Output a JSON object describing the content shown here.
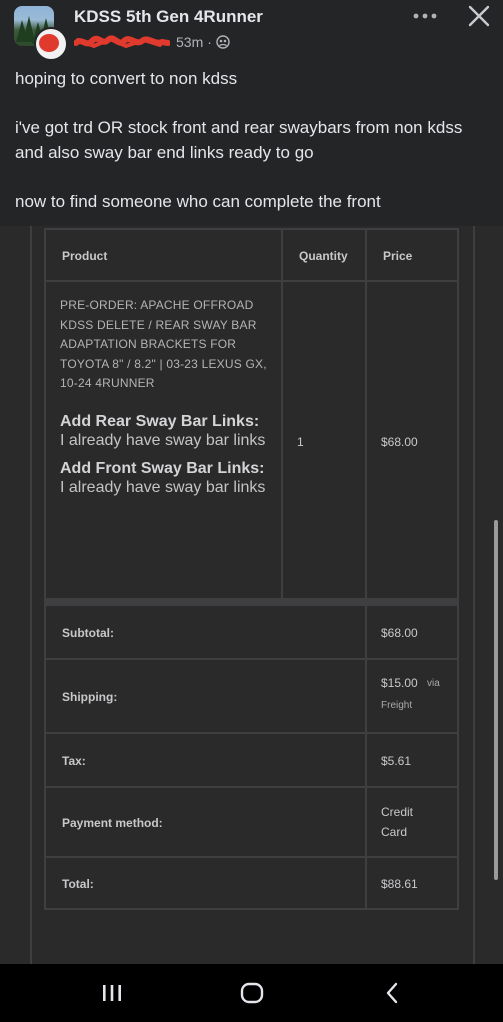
{
  "header": {
    "group_name": "KDSS 5th Gen 4Runner",
    "time": "53m",
    "separator": "·"
  },
  "post": {
    "paragraphs": [
      "hoping to convert to non kdss",
      "i've got trd OR stock front and rear swaybars from non kdss and also sway bar end links ready to go",
      "now to find someone who can complete the front"
    ]
  },
  "order": {
    "headers": {
      "product": "Product",
      "quantity": "Quantity",
      "price": "Price"
    },
    "item": {
      "name": "PRE-ORDER: APACHE OFFROAD KDSS DELETE / REAR SWAY BAR ADAPTATION BRACKETS FOR TOYOTA 8\" / 8.2\" | 03-23 LEXUS GX, 10-24 4RUNNER",
      "addon_1_title": "Add Rear Sway Bar Links:",
      "addon_1_value": "I already have sway bar links",
      "addon_2_title": "Add Front Sway Bar Links:",
      "addon_2_value": "I already have sway bar links",
      "quantity": "1",
      "price": "$68.00"
    },
    "totals": {
      "subtotal_label": "Subtotal:",
      "subtotal_value": "$68.00",
      "shipping_label": "Shipping:",
      "shipping_value": "$15.00",
      "shipping_via": "via",
      "shipping_method": "Freight",
      "tax_label": "Tax:",
      "tax_value": "$5.61",
      "payment_label": "Payment method:",
      "payment_value_1": "Credit",
      "payment_value_2": "Card",
      "total_label": "Total:",
      "total_value": "$88.61"
    }
  },
  "icons": {
    "more": "more-horizontal-icon",
    "close": "close-icon",
    "audience": "group-audience-icon",
    "nav_recents": "recents-icon",
    "nav_home": "home-icon",
    "nav_back": "back-icon"
  },
  "colors": {
    "post_bg": "#242526",
    "text_primary": "#e4e6eb",
    "text_secondary": "#b0b3b8",
    "redaction": "#e03a2f"
  }
}
